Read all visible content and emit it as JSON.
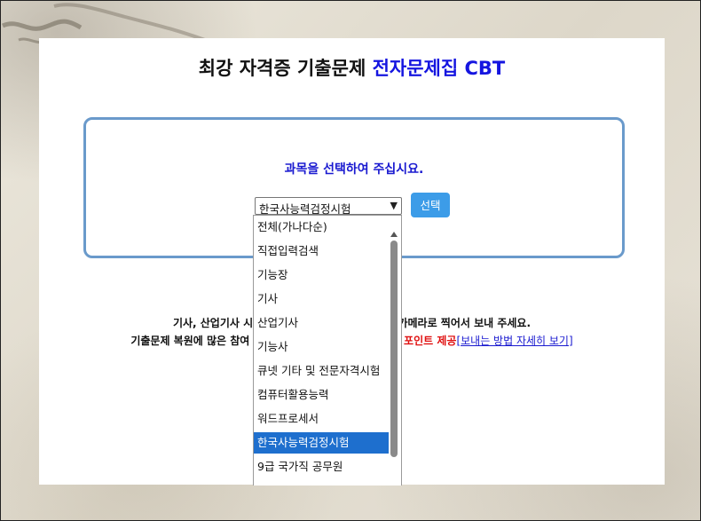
{
  "header": {
    "title_main": "최강 자격증 기출문제 ",
    "title_accent": "전자문제집 CBT"
  },
  "selector": {
    "prompt": "과목을 선택하여 주십시요.",
    "selected_value": "한국사능력검정시험",
    "button_label": "선택",
    "options": [
      "전체(가나다순)",
      "직접입력검색",
      "기능장",
      "기사",
      "산업기사",
      "기능사",
      "큐넷 기타 및 전문자격시험",
      "컴퓨터활용능력",
      "워드프로세서",
      "한국사능력검정시험",
      "9급 국가직 공무원"
    ],
    "selected_index": 9
  },
  "notice": {
    "line1_left": "기사, 산업기사 시험 보",
    "line1_right": "폰카메라로 찍어서 보내 주세요.",
    "line2_left": "기출문제 복원에 많은 참여 부탁 드",
    "line2_red": "또는 포인트 제공",
    "line2_link": "[보내는 방법 자세히 보기]"
  },
  "colors": {
    "accent_blue": "#1515e0",
    "button_blue": "#3c9ce8",
    "border_blue": "#6a9acb",
    "highlight": "#1e6fce",
    "red": "#e01010"
  }
}
